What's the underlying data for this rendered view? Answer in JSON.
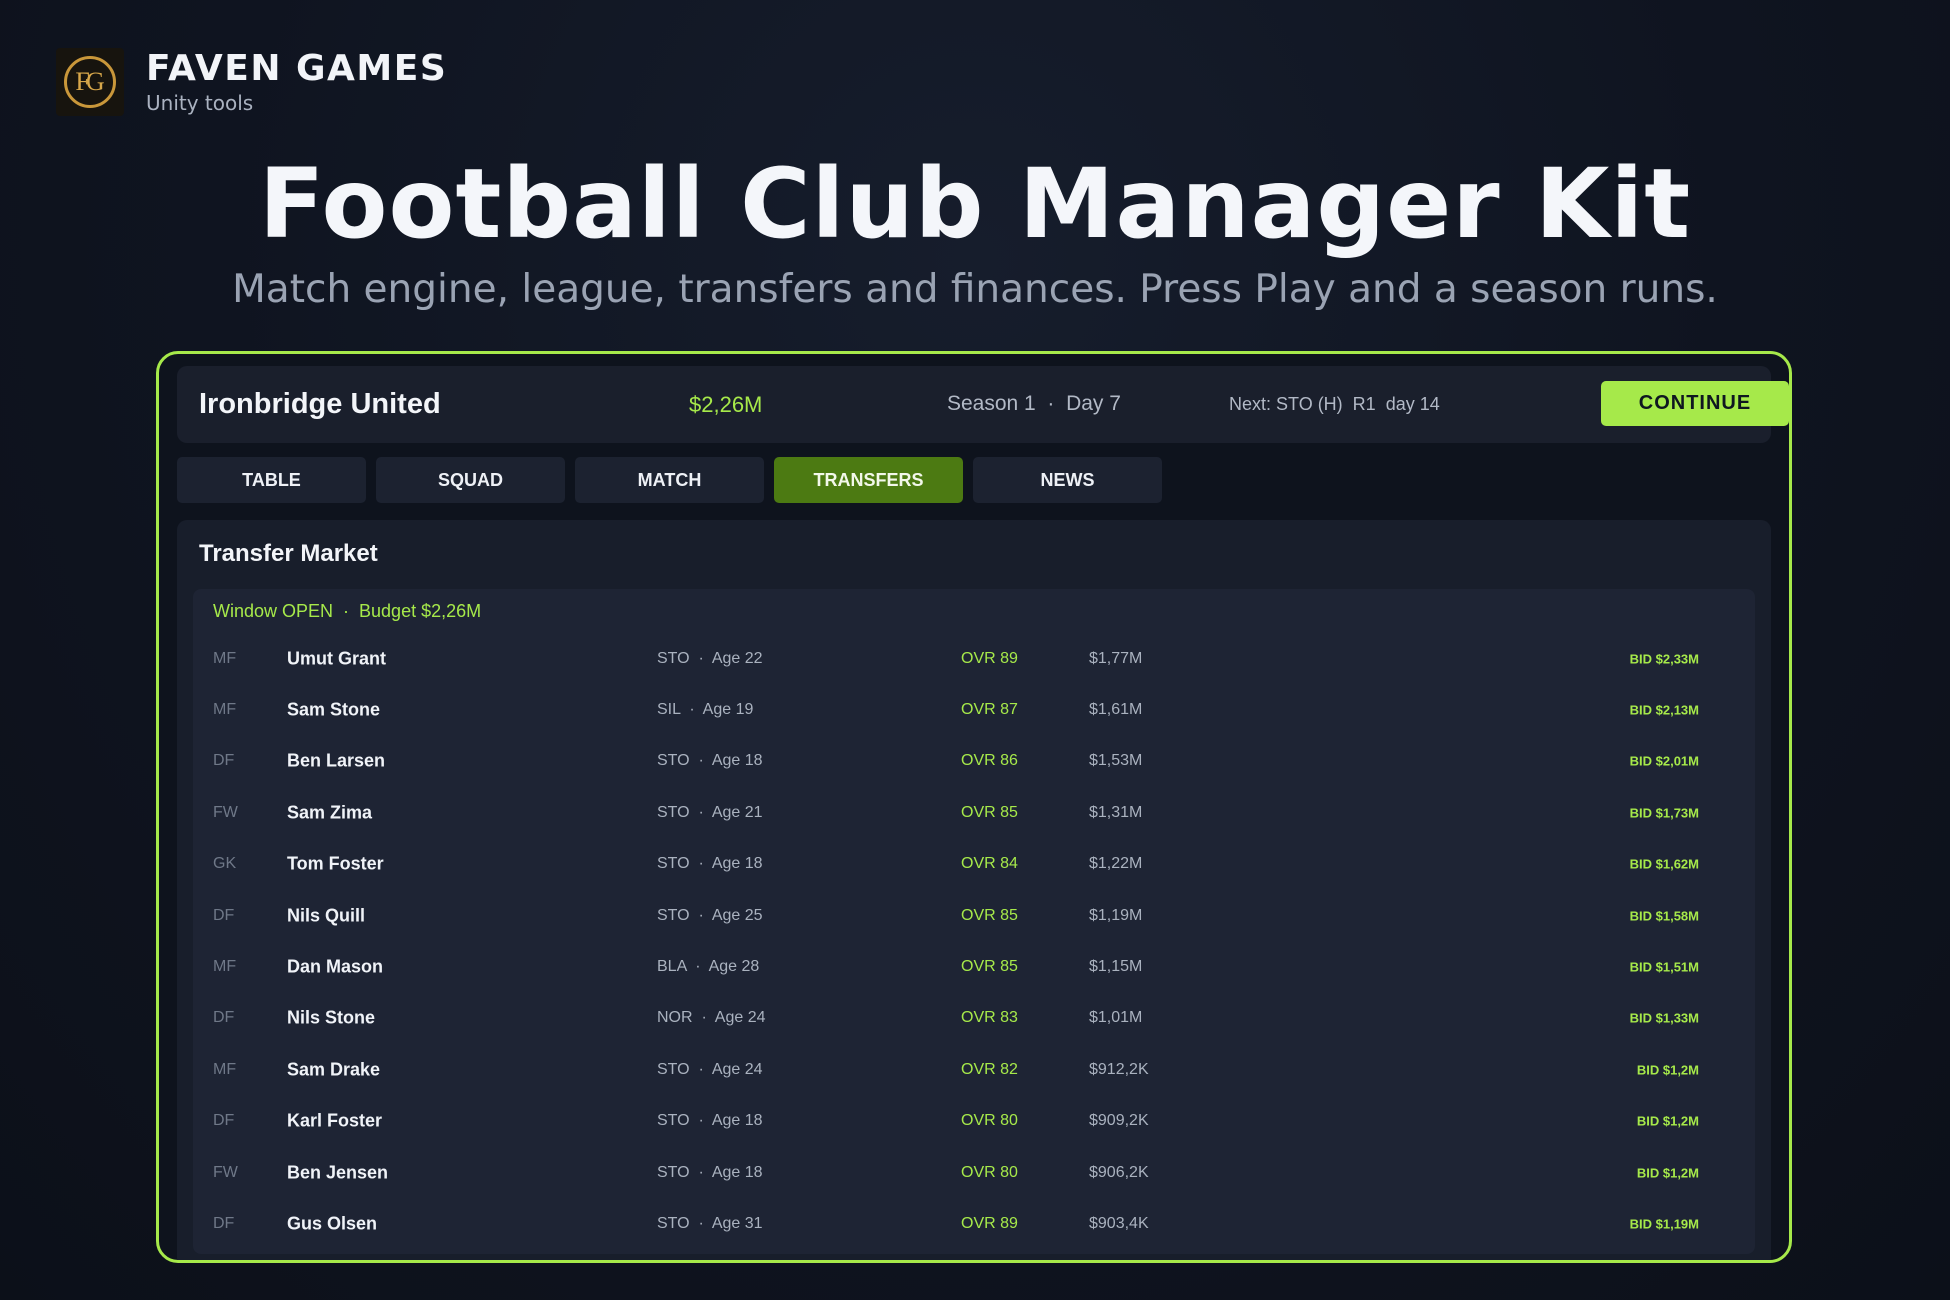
{
  "brand": {
    "logo_text": "FG",
    "name": "FAVEN GAMES",
    "subtitle": "Unity tools"
  },
  "hero": {
    "title": "Football Club Manager Kit",
    "subtitle": "Match engine, league, transfers and finances. Press Play and a season runs."
  },
  "app": {
    "club_name": "Ironbridge United",
    "balance": "$2,26M",
    "season": "Season 1  ·  Day 7",
    "next_match": "Next: STO (H)  R1  day 14",
    "continue_label": "CONTINUE",
    "tabs": [
      {
        "label": "TABLE",
        "active": false
      },
      {
        "label": "SQUAD",
        "active": false
      },
      {
        "label": "MATCH",
        "active": false
      },
      {
        "label": "TRANSFERS",
        "active": true
      },
      {
        "label": "NEWS",
        "active": false
      }
    ],
    "panel_title": "Transfer Market",
    "window_status": "Window OPEN  ·  Budget $2,26M",
    "players": [
      {
        "pos": "MF",
        "name": "Umut Grant",
        "club_age": "STO  ·  Age 22",
        "ovr": "OVR 89",
        "value": "$1,77M",
        "bid": "BID $2,33M"
      },
      {
        "pos": "MF",
        "name": "Sam Stone",
        "club_age": "SIL  ·  Age 19",
        "ovr": "OVR 87",
        "value": "$1,61M",
        "bid": "BID $2,13M"
      },
      {
        "pos": "DF",
        "name": "Ben Larsen",
        "club_age": "STO  ·  Age 18",
        "ovr": "OVR 86",
        "value": "$1,53M",
        "bid": "BID $2,01M"
      },
      {
        "pos": "FW",
        "name": "Sam Zima",
        "club_age": "STO  ·  Age 21",
        "ovr": "OVR 85",
        "value": "$1,31M",
        "bid": "BID $1,73M"
      },
      {
        "pos": "GK",
        "name": "Tom Foster",
        "club_age": "STO  ·  Age 18",
        "ovr": "OVR 84",
        "value": "$1,22M",
        "bid": "BID $1,62M"
      },
      {
        "pos": "DF",
        "name": "Nils Quill",
        "club_age": "STO  ·  Age 25",
        "ovr": "OVR 85",
        "value": "$1,19M",
        "bid": "BID $1,58M"
      },
      {
        "pos": "MF",
        "name": "Dan Mason",
        "club_age": "BLA  ·  Age 28",
        "ovr": "OVR 85",
        "value": "$1,15M",
        "bid": "BID $1,51M"
      },
      {
        "pos": "DF",
        "name": "Nils Stone",
        "club_age": "NOR  ·  Age 24",
        "ovr": "OVR 83",
        "value": "$1,01M",
        "bid": "BID $1,33M"
      },
      {
        "pos": "MF",
        "name": "Sam Drake",
        "club_age": "STO  ·  Age 24",
        "ovr": "OVR 82",
        "value": "$912,2K",
        "bid": "BID $1,2M"
      },
      {
        "pos": "DF",
        "name": "Karl Foster",
        "club_age": "STO  ·  Age 18",
        "ovr": "OVR 80",
        "value": "$909,2K",
        "bid": "BID $1,2M"
      },
      {
        "pos": "FW",
        "name": "Ben Jensen",
        "club_age": "STO  ·  Age 18",
        "ovr": "OVR 80",
        "value": "$906,2K",
        "bid": "BID $1,2M"
      },
      {
        "pos": "DF",
        "name": "Gus Olsen",
        "club_age": "STO  ·  Age 31",
        "ovr": "OVR 89",
        "value": "$903,4K",
        "bid": "BID $1,19M"
      }
    ]
  },
  "colors": {
    "accent": "#a6e94a",
    "active_tab": "#4c7a12",
    "background": "#0f1420"
  }
}
